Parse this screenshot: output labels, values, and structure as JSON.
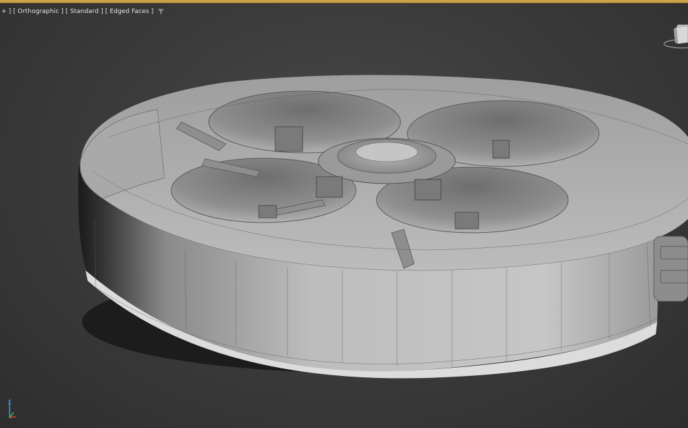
{
  "viewport": {
    "label_prefix": "+ ]",
    "label_view": "[ Orthographic ]",
    "label_shading": "[ Standard ]",
    "label_display": "[ Edged Faces ]"
  },
  "icons": {
    "filter": "filter-icon",
    "viewcube": "viewcube-icon",
    "axis": "axis-tripod-icon"
  },
  "colors": {
    "accent_border": "#c9a24a",
    "viewport_bg": "#3c3c3c",
    "model_shade": "#b8b8b8"
  }
}
